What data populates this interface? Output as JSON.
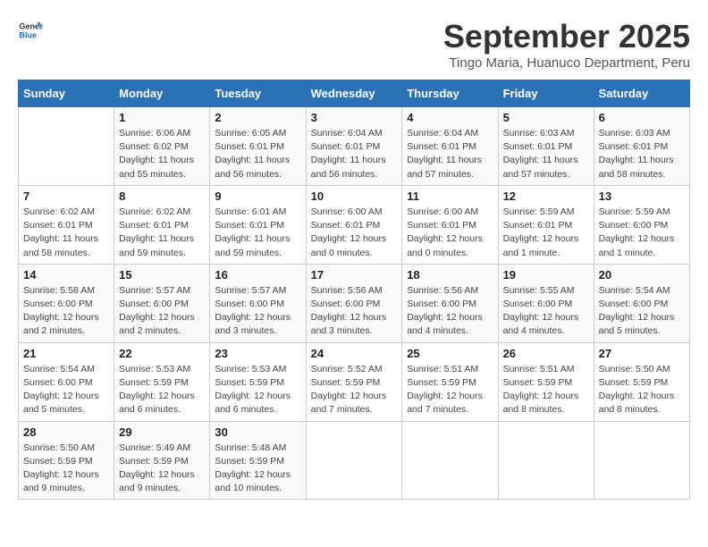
{
  "header": {
    "logo_general": "General",
    "logo_blue": "Blue",
    "month_title": "September 2025",
    "location": "Tingo Maria, Huanuco Department, Peru"
  },
  "weekdays": [
    "Sunday",
    "Monday",
    "Tuesday",
    "Wednesday",
    "Thursday",
    "Friday",
    "Saturday"
  ],
  "weeks": [
    [
      {
        "day": "",
        "info": ""
      },
      {
        "day": "1",
        "info": "Sunrise: 6:06 AM\nSunset: 6:02 PM\nDaylight: 11 hours\nand 55 minutes."
      },
      {
        "day": "2",
        "info": "Sunrise: 6:05 AM\nSunset: 6:01 PM\nDaylight: 11 hours\nand 56 minutes."
      },
      {
        "day": "3",
        "info": "Sunrise: 6:04 AM\nSunset: 6:01 PM\nDaylight: 11 hours\nand 56 minutes."
      },
      {
        "day": "4",
        "info": "Sunrise: 6:04 AM\nSunset: 6:01 PM\nDaylight: 11 hours\nand 57 minutes."
      },
      {
        "day": "5",
        "info": "Sunrise: 6:03 AM\nSunset: 6:01 PM\nDaylight: 11 hours\nand 57 minutes."
      },
      {
        "day": "6",
        "info": "Sunrise: 6:03 AM\nSunset: 6:01 PM\nDaylight: 11 hours\nand 58 minutes."
      }
    ],
    [
      {
        "day": "7",
        "info": "Sunrise: 6:02 AM\nSunset: 6:01 PM\nDaylight: 11 hours\nand 58 minutes."
      },
      {
        "day": "8",
        "info": "Sunrise: 6:02 AM\nSunset: 6:01 PM\nDaylight: 11 hours\nand 59 minutes."
      },
      {
        "day": "9",
        "info": "Sunrise: 6:01 AM\nSunset: 6:01 PM\nDaylight: 11 hours\nand 59 minutes."
      },
      {
        "day": "10",
        "info": "Sunrise: 6:00 AM\nSunset: 6:01 PM\nDaylight: 12 hours\nand 0 minutes."
      },
      {
        "day": "11",
        "info": "Sunrise: 6:00 AM\nSunset: 6:01 PM\nDaylight: 12 hours\nand 0 minutes."
      },
      {
        "day": "12",
        "info": "Sunrise: 5:59 AM\nSunset: 6:01 PM\nDaylight: 12 hours\nand 1 minute."
      },
      {
        "day": "13",
        "info": "Sunrise: 5:59 AM\nSunset: 6:00 PM\nDaylight: 12 hours\nand 1 minute."
      }
    ],
    [
      {
        "day": "14",
        "info": "Sunrise: 5:58 AM\nSunset: 6:00 PM\nDaylight: 12 hours\nand 2 minutes."
      },
      {
        "day": "15",
        "info": "Sunrise: 5:57 AM\nSunset: 6:00 PM\nDaylight: 12 hours\nand 2 minutes."
      },
      {
        "day": "16",
        "info": "Sunrise: 5:57 AM\nSunset: 6:00 PM\nDaylight: 12 hours\nand 3 minutes."
      },
      {
        "day": "17",
        "info": "Sunrise: 5:56 AM\nSunset: 6:00 PM\nDaylight: 12 hours\nand 3 minutes."
      },
      {
        "day": "18",
        "info": "Sunrise: 5:56 AM\nSunset: 6:00 PM\nDaylight: 12 hours\nand 4 minutes."
      },
      {
        "day": "19",
        "info": "Sunrise: 5:55 AM\nSunset: 6:00 PM\nDaylight: 12 hours\nand 4 minutes."
      },
      {
        "day": "20",
        "info": "Sunrise: 5:54 AM\nSunset: 6:00 PM\nDaylight: 12 hours\nand 5 minutes."
      }
    ],
    [
      {
        "day": "21",
        "info": "Sunrise: 5:54 AM\nSunset: 6:00 PM\nDaylight: 12 hours\nand 5 minutes."
      },
      {
        "day": "22",
        "info": "Sunrise: 5:53 AM\nSunset: 5:59 PM\nDaylight: 12 hours\nand 6 minutes."
      },
      {
        "day": "23",
        "info": "Sunrise: 5:53 AM\nSunset: 5:59 PM\nDaylight: 12 hours\nand 6 minutes."
      },
      {
        "day": "24",
        "info": "Sunrise: 5:52 AM\nSunset: 5:59 PM\nDaylight: 12 hours\nand 7 minutes."
      },
      {
        "day": "25",
        "info": "Sunrise: 5:51 AM\nSunset: 5:59 PM\nDaylight: 12 hours\nand 7 minutes."
      },
      {
        "day": "26",
        "info": "Sunrise: 5:51 AM\nSunset: 5:59 PM\nDaylight: 12 hours\nand 8 minutes."
      },
      {
        "day": "27",
        "info": "Sunrise: 5:50 AM\nSunset: 5:59 PM\nDaylight: 12 hours\nand 8 minutes."
      }
    ],
    [
      {
        "day": "28",
        "info": "Sunrise: 5:50 AM\nSunset: 5:59 PM\nDaylight: 12 hours\nand 9 minutes."
      },
      {
        "day": "29",
        "info": "Sunrise: 5:49 AM\nSunset: 5:59 PM\nDaylight: 12 hours\nand 9 minutes."
      },
      {
        "day": "30",
        "info": "Sunrise: 5:48 AM\nSunset: 5:59 PM\nDaylight: 12 hours\nand 10 minutes."
      },
      {
        "day": "",
        "info": ""
      },
      {
        "day": "",
        "info": ""
      },
      {
        "day": "",
        "info": ""
      },
      {
        "day": "",
        "info": ""
      }
    ]
  ]
}
